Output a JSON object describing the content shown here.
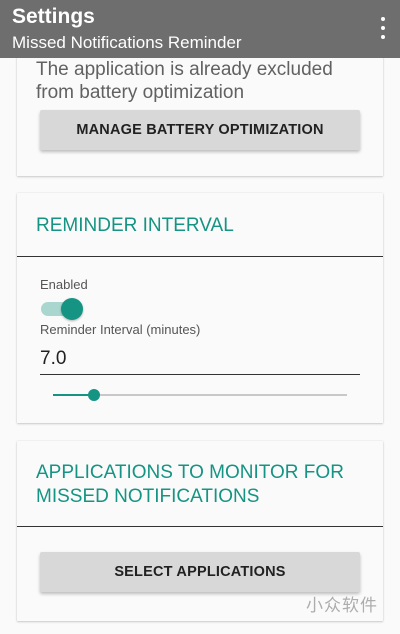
{
  "toolbar": {
    "title": "Settings",
    "subtitle": "Missed Notifications Reminder",
    "menu_icon": "overflow-menu-icon"
  },
  "battery": {
    "status_text": "The application is already excluded from battery optimization",
    "button_label": "MANAGE BATTERY OPTIMIZATION"
  },
  "interval": {
    "section_title": "REMINDER INTERVAL",
    "enabled_label": "Enabled",
    "enabled": true,
    "field_label": "Reminder Interval (minutes)",
    "value": "7.0",
    "slider_fraction": 0.14
  },
  "apps": {
    "section_title": "APPLICATIONS TO MONITOR FOR MISSED NOTIFICATIONS",
    "button_label": "SELECT APPLICATIONS"
  },
  "watermark": "小众软件",
  "colors": {
    "toolbar": "#6e6e6e",
    "accent": "#159483",
    "switch_track": "#a9d7cf",
    "button": "#d8d8d8"
  }
}
